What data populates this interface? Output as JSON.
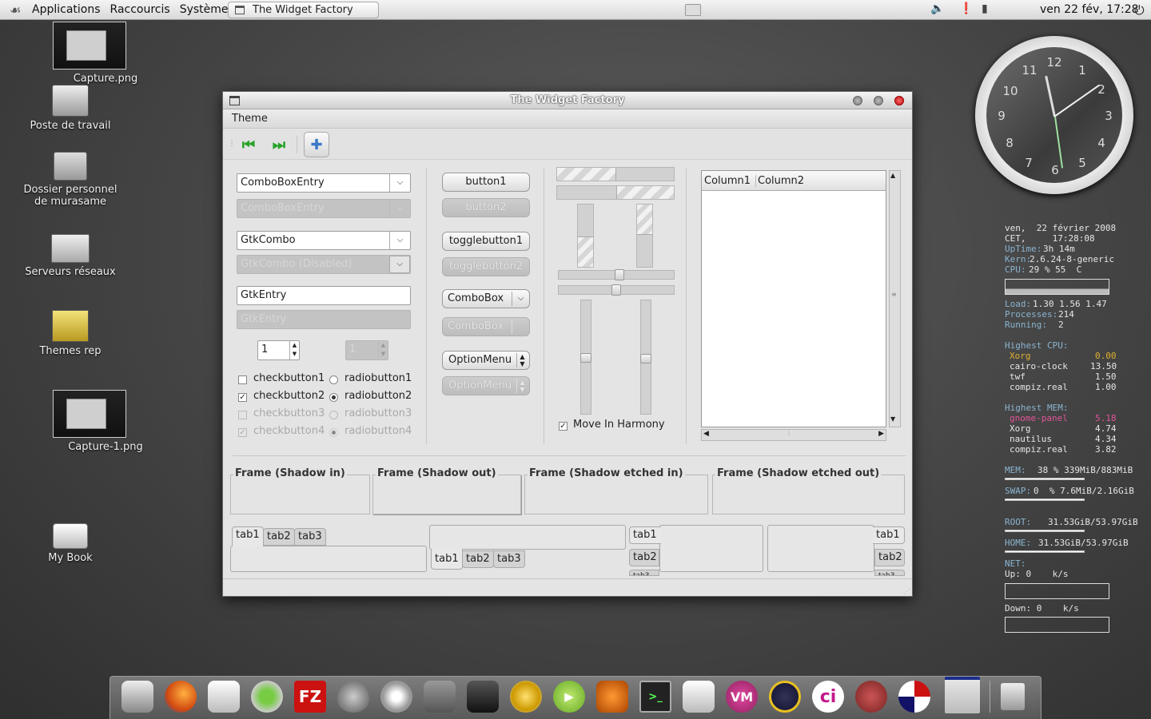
{
  "top_panel": {
    "menus": [
      "Applications",
      "Raccourcis",
      "Système"
    ],
    "task": "The Widget Factory",
    "clock": "ven 22 fév, 17:28"
  },
  "desktop_icons": [
    "Capture.png",
    "Poste de travail",
    "Dossier personnel de murasame",
    "Serveurs réseaux",
    "Themes rep",
    "Capture-1.png",
    "My Book"
  ],
  "window": {
    "title": "The Widget Factory",
    "menu_theme": "Theme",
    "col1": {
      "combo_entry": "ComboBoxEntry",
      "combo_entry_dis": "ComboBoxEntry",
      "gtkcombo": "GtkCombo",
      "gtkcombo_dis": "GtkCombo (Disabled)",
      "entry": "GtkEntry",
      "entry_dis": "GtkEntry",
      "spin": "1",
      "spin_dis": "1",
      "checks": [
        "checkbutton1",
        "checkbutton2",
        "checkbutton3",
        "checkbutton4"
      ],
      "radios": [
        "radiobutton1",
        "radiobutton2",
        "radiobutton3",
        "radiobutton4"
      ]
    },
    "col2": {
      "button1": "button1",
      "button2": "button2",
      "toggle1": "togglebutton1",
      "toggle2": "togglebutton2",
      "combobox": "ComboBox",
      "combobox_dis": "ComboBox",
      "optionmenu": "OptionMenu",
      "optionmenu_dis": "OptionMenu"
    },
    "move_in_harmony": "Move In Harmony",
    "tree": {
      "columns": [
        "Column1",
        "Column2"
      ]
    },
    "frames": [
      "Frame (Shadow in)",
      "Frame (Shadow out)",
      "Frame (Shadow etched in)",
      "Frame (Shadow etched out)"
    ],
    "tabs": [
      "tab1",
      "tab2",
      "tab3"
    ]
  },
  "clock_numbers": [
    "12",
    "1",
    "2",
    "3",
    "4",
    "5",
    "6",
    "7",
    "8",
    "9",
    "10",
    "11"
  ],
  "conky": {
    "l1": "ven,  22 février 2008",
    "l2": "CET,     17:28:08",
    "l3_lab": "UpTime:",
    "l3_val": "3h 14m",
    "l4_lab": "Kern:",
    "l4_val": "2.6.24-8-generic",
    "l5_lab": "CPU:",
    "l5_val": "29 % 55  C",
    "l6_lab": "Load:",
    "l6_val": "1.30 1.56 1.47",
    "l7_lab": "Processes:",
    "l7_val": "214",
    "l8_lab": "Running:",
    "l8_val": "2",
    "hcpu": "Highest CPU:",
    "cpu_rows": [
      [
        "Xorg",
        "0.00"
      ],
      [
        "cairo-clock",
        "13.50"
      ],
      [
        "twf",
        "1.50"
      ],
      [
        "compiz.real",
        "1.00"
      ]
    ],
    "hmem": "Highest MEM:",
    "mem_rows": [
      [
        "gnome-panel",
        "5.18"
      ],
      [
        "Xorg",
        "4.74"
      ],
      [
        "nautilus",
        "4.34"
      ],
      [
        "compiz.real",
        "3.82"
      ]
    ],
    "mem_lab": "MEM:",
    "mem_val": "38 % 339MiB/883MiB",
    "swap_lab": "SWAP:",
    "swap_val": "0  % 7.6MiB/2.16GiB",
    "root_lab": "ROOT:",
    "root_val": "31.53GiB/53.97GiB",
    "home_lab": "HOME:",
    "home_val": "31.53GiB/53.97GiB",
    "net_lab": "NET:",
    "up": "Up: 0    k/s",
    "down": "Down: 0    k/s"
  },
  "dock_icons": [
    "computer-icon",
    "firefox-icon",
    "mail-icon",
    "messenger-icon",
    "filezilla-icon",
    "drop-icon",
    "wheel-icon",
    "gimp-icon",
    "inkscape-icon",
    "globe-icon",
    "play-icon",
    "burn-icon",
    "terminal-icon",
    "media-icon",
    "vm-icon",
    "emblem-icon",
    "ci-icon",
    "violin-icon",
    "flag-icon",
    "window-icon",
    "trash-icon"
  ],
  "dock_labels": {
    "fz": "FZ",
    "vm": "VM",
    "ci": "ci",
    "term": ">_"
  }
}
